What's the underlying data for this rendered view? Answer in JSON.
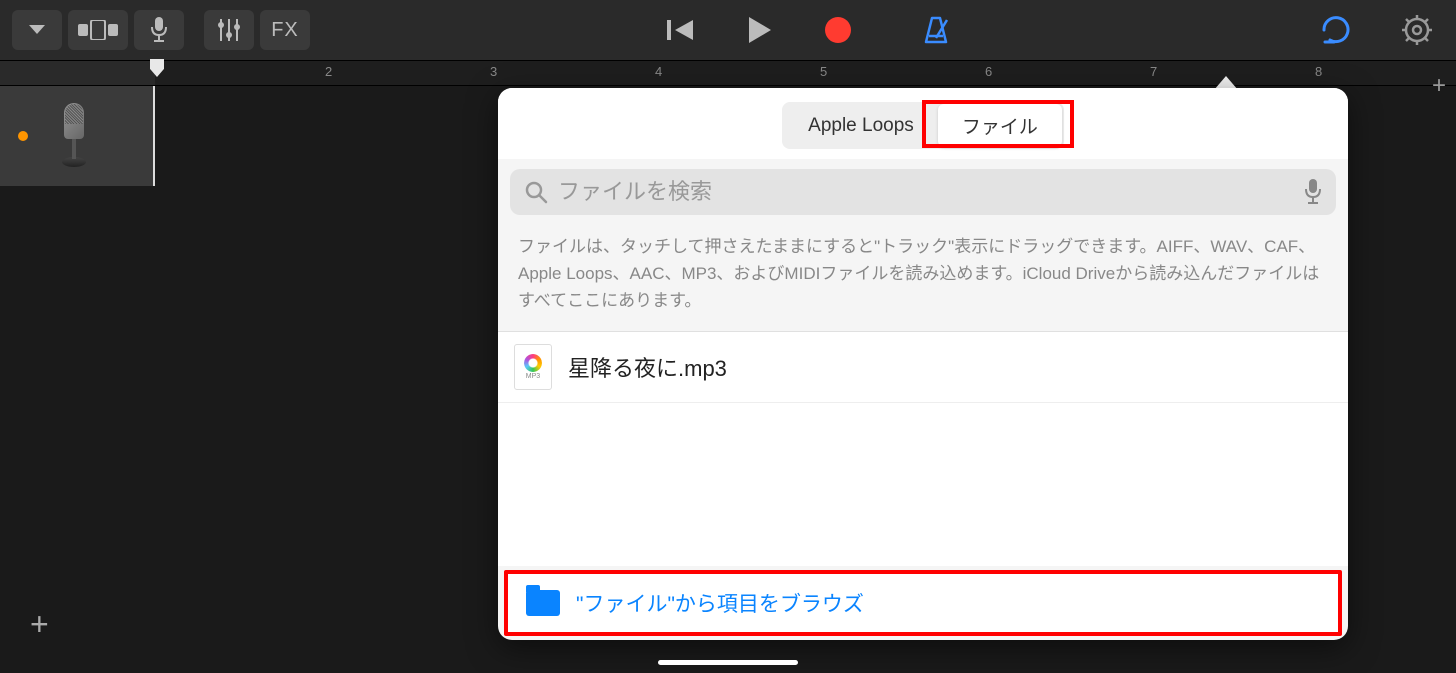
{
  "toolbar": {
    "fx_label": "FX"
  },
  "ruler": {
    "marks": [
      "2",
      "3",
      "4",
      "5",
      "6",
      "7",
      "8"
    ]
  },
  "popover": {
    "tabs": {
      "loops": "Apple Loops",
      "files": "ファイル"
    },
    "search": {
      "placeholder": "ファイルを検索"
    },
    "helper": "ファイルは、タッチして押さえたままにすると\"トラック\"表示にドラッグできます。AIFF、WAV、CAF、Apple Loops、AAC、MP3、およびMIDIファイルを読み込めます。iCloud Driveから読み込んだファイルはすべてここにあります。",
    "files": [
      {
        "name": "星降る夜に.mp3",
        "type": "MP3"
      }
    ],
    "browse_label": "\"ファイル\"から項目をブラウズ"
  }
}
